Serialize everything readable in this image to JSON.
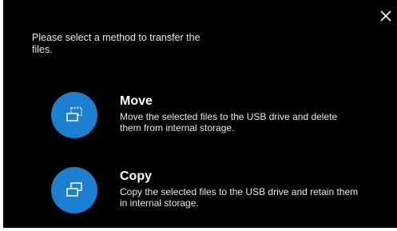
{
  "dialog": {
    "prompt": "Please select a method to transfer the files.",
    "close_icon": "close-icon",
    "options": [
      {
        "title": "Move",
        "description": "Move the selected files to the USB drive and delete them from internal storage.",
        "icon": "move-files-icon"
      },
      {
        "title": "Copy",
        "description": "Copy the selected files to the USB drive and retain them in internal storage.",
        "icon": "copy-files-icon"
      }
    ]
  },
  "colors": {
    "background": "#000000",
    "accent": "#1c7fd0",
    "text": "#ffffff"
  }
}
